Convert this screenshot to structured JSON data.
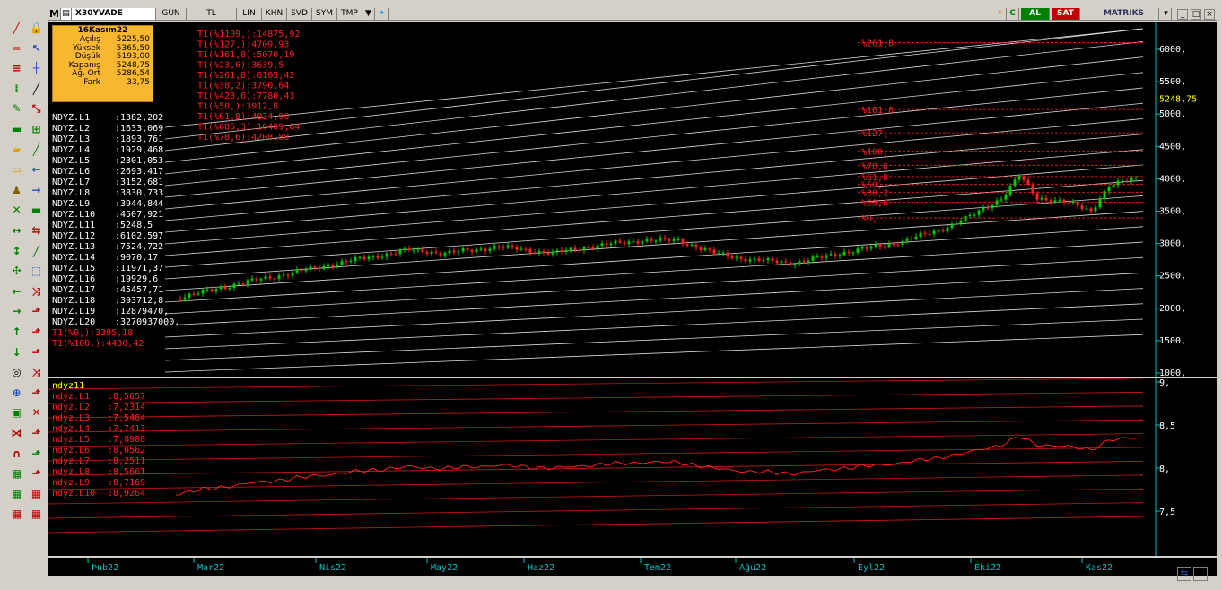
{
  "toolbar": {
    "m_label": "M",
    "symbol": "X30YVADE",
    "period": "GUN",
    "currency": "TL",
    "buttons": [
      "LIN",
      "KHN",
      "SVD",
      "SYM",
      "TMP"
    ],
    "buy": "AL",
    "sell": "SAT",
    "brand": "MATRIKS",
    "icon_names": [
      "chart-type-icon",
      "dropdown-icon",
      "twitter-icon",
      "lightning-icon",
      "refresh-icon",
      "minimize-icon",
      "maximize-icon",
      "close-icon"
    ]
  },
  "info": {
    "date": "16Kasım22",
    "rows": [
      {
        "label": "Açılış",
        "value": "5225,50"
      },
      {
        "label": "Yüksek",
        "value": "5365,50"
      },
      {
        "label": "Düşük",
        "value": "5193,00"
      },
      {
        "label": "Kapanış",
        "value": "5248,75"
      },
      {
        "label": "Ağ. Ort",
        "value": "5286,54"
      },
      {
        "label": "Fark",
        "value": "33,75"
      }
    ]
  },
  "fib_labels": [
    "T1(%1109,):14875,92",
    "T1(%127,):4709,93",
    "T1(%161,8):5070,19",
    "T1(%23,6):3639,5",
    "T1(%261,8):6105,42",
    "T1(%38,2):3790,64",
    "T1(%423,6):7780,43",
    "T1(%50,):3912,8",
    "T1(%61,8):4034,96",
    "T1(%685,3):10489,64",
    "T1(%78,6):4208,88"
  ],
  "ndyz_labels": [
    {
      "name": "NDYZ.L1",
      "value": ":1382,202"
    },
    {
      "name": "NDYZ.L2",
      "value": ":1633,069"
    },
    {
      "name": "NDYZ.L3",
      "value": ":1893,761"
    },
    {
      "name": "NDYZ.L4",
      "value": ":1929,468"
    },
    {
      "name": "NDYZ.L5",
      "value": ":2301,053"
    },
    {
      "name": "NDYZ.L6",
      "value": ":2693,417"
    },
    {
      "name": "NDYZ.L7",
      "value": ":3152,681"
    },
    {
      "name": "NDYZ.L8",
      "value": ":3830,733"
    },
    {
      "name": "NDYZ.L9",
      "value": ":3944,844"
    },
    {
      "name": "NDYZ.L10",
      "value": ":4507,921"
    },
    {
      "name": "NDYZ.L11",
      "value": ":5248,5"
    },
    {
      "name": "NDYZ.L12",
      "value": ":6102,597"
    },
    {
      "name": "NDYZ.L13",
      "value": ":7524,722"
    },
    {
      "name": "NDYZ.L14",
      "value": ":9070,17"
    },
    {
      "name": "NDYZ.L15",
      "value": ":11971,37"
    },
    {
      "name": "NDYZ.L16",
      "value": ":19929,6"
    },
    {
      "name": "NDYZ.L17",
      "value": ":45457,71"
    },
    {
      "name": "NDYZ.L18",
      "value": ":393712,8"
    },
    {
      "name": "NDYZ.L19",
      "value": ":12879470,"
    },
    {
      "name": "NDYZ.L20",
      "value": ":3270937000,"
    }
  ],
  "t1_bottom": [
    "T1(%0,):3395,18",
    "T1(%100,):4430,42"
  ],
  "fib_right_labels": [
    "%261,8",
    "%161,8",
    "%127,",
    "%100,",
    "%78,6",
    "%61,8",
    "%50,",
    "%38,2",
    "%23,6",
    "%0,"
  ],
  "price_axis": [
    "6000,",
    "5500,",
    "5000,",
    "4500,",
    "4000,",
    "3500,",
    "3000,",
    "2500,",
    "2000,",
    "1500,",
    "1000,"
  ],
  "last_price": "5248,75",
  "osc": {
    "title": "ndyz11",
    "labels": [
      {
        "name": "ndyz.L1",
        "value": ":8,5657"
      },
      {
        "name": "ndyz.L2",
        "value": ":7,2314"
      },
      {
        "name": "ndyz.L3",
        "value": ":7,5464"
      },
      {
        "name": "ndyz.L4",
        "value": ":7,7413"
      },
      {
        "name": "ndyz.L5",
        "value": ":7,8988"
      },
      {
        "name": "ndyz.L6",
        "value": ":8,0562"
      },
      {
        "name": "ndyz.L7",
        "value": ":8,2511"
      },
      {
        "name": "ndyz.L8",
        "value": ":8,5661"
      },
      {
        "name": "ndyz.L9",
        "value": ":8,7169"
      },
      {
        "name": "ndyz.L10",
        "value": ":8,9264"
      }
    ],
    "axis": [
      "9,",
      "8,5",
      "8,",
      "7,5"
    ]
  },
  "months": [
    "Þub22",
    "Mar22",
    "Nis22",
    "May22",
    "Haz22",
    "Tem22",
    "Ağu22",
    "Eyl22",
    "Eki22",
    "Kas22"
  ],
  "colors": {
    "up": "#00cc00",
    "down": "#ff2020",
    "fib": "#ff2020",
    "ndyz_line": "#ffffff",
    "axis": "#00c0c0",
    "osc_line": "#ff2020"
  }
}
